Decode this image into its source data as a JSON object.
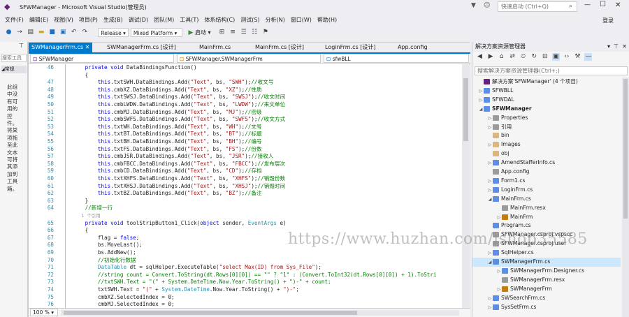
{
  "window": {
    "title": "SFWManager - Microsoft Visual Studio(管理员)",
    "quick_launch_placeholder": "快速启动 (Ctrl+Q)",
    "login_label": "登录"
  },
  "menu": [
    "文件(F)",
    "编辑(E)",
    "视图(V)",
    "项目(P)",
    "生成(B)",
    "调试(D)",
    "团队(M)",
    "工具(T)",
    "体系结构(C)",
    "测试(S)",
    "分析(N)",
    "窗口(W)",
    "帮助(H)"
  ],
  "toolbar": {
    "config": "Release",
    "platform": "Mixed Platform",
    "start_label": "启动"
  },
  "left_pane": {
    "search_placeholder": "搜索工具",
    "header": "常规",
    "message": "此组中没有可用的控件。将某项拖至此文本可将其添加到工具箱。"
  },
  "tabs": [
    {
      "label": "SWManagerFrm.cs",
      "active": true
    },
    {
      "label": "SWManagerFrm.cs [设计]",
      "active": false
    },
    {
      "label": "MainFrm.cs",
      "active": false
    },
    {
      "label": "MainFrm.cs [设计]",
      "active": false
    },
    {
      "label": "LoginFrm.cs [设计]",
      "active": false
    },
    {
      "label": "App.config",
      "active": false
    }
  ],
  "nav": {
    "project": "SFWManager",
    "class": "SFWManager.SWManagerFrm",
    "member": "sfwBLL"
  },
  "code_lines": [
    {
      "n": "46",
      "t": "        private void DataBindingsFunction()"
    },
    {
      "n": "",
      "t": "        {"
    },
    {
      "n": "47",
      "t": "            this.txtSWH.DataBindings.Add(\"Text\", bs, \"SWH\");//收文号"
    },
    {
      "n": "48",
      "t": "            this.cmbXZ.DataBindings.Add(\"Text\", bs, \"XZ\");//性质"
    },
    {
      "n": "49",
      "t": "            this.txtSWSJ.DataBindings.Add(\"Text\", bs, \"SWSJ\");//收文时间"
    },
    {
      "n": "50",
      "t": "            this.cmbLWDW.DataBindings.Add(\"Text\", bs, \"LWDW\");//来文单位"
    },
    {
      "n": "51",
      "t": "            this.cmbMJ.DataBindings.Add(\"Text\", bs, \"MJ\");//密级"
    },
    {
      "n": "52",
      "t": "            this.cmbSWFS.DataBindings.Add(\"Text\", bs, \"SWFS\");//收文方式"
    },
    {
      "n": "53",
      "t": "            this.txtWH.DataBindings.Add(\"Text\", bs, \"WH\");//文号"
    },
    {
      "n": "54",
      "t": "            this.txtBT.DataBindings.Add(\"Text\", bs, \"BT\");//标题"
    },
    {
      "n": "55",
      "t": "            this.txtBH.DataBindings.Add(\"Text\", bs, \"BH\");//编号"
    },
    {
      "n": "56",
      "t": "            this.txtFS.DataBindings.Add(\"Text\", bs, \"FS\");//份数"
    },
    {
      "n": "57",
      "t": "            this.cmbJSR.DataBindings.Add(\"Text\", bs, \"JSR\");//接收人"
    },
    {
      "n": "58",
      "t": "            this.cmbFBCC.DataBindings.Add(\"Text\", bs, \"FBCC\");//发布层次"
    },
    {
      "n": "59",
      "t": "            this.cmbCD.DataBindings.Add(\"Text\", bs, \"CD\");//存档"
    },
    {
      "n": "60",
      "t": "            this.txtXHFS.DataBindings.Add(\"Text\", bs, \"XHFS\");//销毁份数"
    },
    {
      "n": "61",
      "t": "            this.txtXHSJ.DataBindings.Add(\"Text\", bs, \"XHSJ\");//销毁时间"
    },
    {
      "n": "62",
      "t": "            this.txtBZ.DataBindings.Add(\"Text\", bs, \"BZ\");//备注"
    },
    {
      "n": "63",
      "t": "        }"
    },
    {
      "n": "64",
      "t": "        //新增一行"
    },
    {
      "n": "",
      "t": "        1 个引用"
    },
    {
      "n": "65",
      "t": "        private void toolStripButton1_Click(object sender, EventArgs e)"
    },
    {
      "n": "66",
      "t": "        {"
    },
    {
      "n": "67",
      "t": "            flag = false;"
    },
    {
      "n": "68",
      "t": "            bs.MoveLast();"
    },
    {
      "n": "69",
      "t": "            bs.AddNew();"
    },
    {
      "n": "70",
      "t": "            //初始化行数据"
    },
    {
      "n": "71",
      "t": "            DataTable dt = sqlHelper.ExecuteTable(\"select Max(ID) from Sys_File\");"
    },
    {
      "n": "72",
      "t": "            //string count = Convert.ToString(dt.Rows[0][0]) == \"\" ? \"1\" : (Convert.ToInt32(dt.Rows[0][0]) + 1).ToStri"
    },
    {
      "n": "73",
      "t": "            //txtSWH.Text = \"(\" + System.DateTime.Now.Year.ToString() + \")-\" + count;"
    },
    {
      "n": "74",
      "t": "            txtSWH.Text = \"(\" + System.DateTime.Now.Year.ToString() + \")-\";"
    },
    {
      "n": "75",
      "t": "            cmbXZ.SelectedIndex = 0;"
    },
    {
      "n": "76",
      "t": "            cmbMJ.SelectedIndex = 0;"
    }
  ],
  "zoom": "100 %",
  "watermark": "https://www.huzhan.com/ishop35585",
  "solution": {
    "title": "解决方案资源管理器",
    "search_placeholder": "搜索解决方案资源管理器(Ctrl+;)",
    "items": [
      {
        "label": "解决方案'SFWManager' (4 个项目)",
        "level": 0,
        "exp": "",
        "icon": "#68217a"
      },
      {
        "label": "SFWBLL",
        "level": 0,
        "exp": "▷",
        "icon": "#5c8ee6"
      },
      {
        "label": "SFWDAL",
        "level": 0,
        "exp": "▷",
        "icon": "#5c8ee6"
      },
      {
        "label": "SFWManager",
        "level": 0,
        "exp": "◢",
        "icon": "#5c8ee6",
        "bold": true
      },
      {
        "label": "Properties",
        "level": 1,
        "exp": "▷",
        "icon": "#9b9b9b"
      },
      {
        "label": "引用",
        "level": 1,
        "exp": "▷",
        "icon": "#9b9b9b"
      },
      {
        "label": "bin",
        "level": 1,
        "exp": "",
        "icon": "#dcb67a"
      },
      {
        "label": "Images",
        "level": 1,
        "exp": "▷",
        "icon": "#dcb67a"
      },
      {
        "label": "obj",
        "level": 1,
        "exp": "",
        "icon": "#dcb67a"
      },
      {
        "label": "AmendStafferInfo.cs",
        "level": 1,
        "exp": "▷",
        "icon": "#5c8ee6"
      },
      {
        "label": "App.config",
        "level": 1,
        "exp": "",
        "icon": "#9b9b9b"
      },
      {
        "label": "Form1.cs",
        "level": 1,
        "exp": "▷",
        "icon": "#5c8ee6"
      },
      {
        "label": "LoginFrm.cs",
        "level": 1,
        "exp": "▷",
        "icon": "#5c8ee6"
      },
      {
        "label": "MainFrm.cs",
        "level": 1,
        "exp": "◢",
        "icon": "#5c8ee6"
      },
      {
        "label": "MainFrm.resx",
        "level": 2,
        "exp": "",
        "icon": "#9b9b9b"
      },
      {
        "label": "MainFrm",
        "level": 2,
        "exp": "▷",
        "icon": "#c27d0e"
      },
      {
        "label": "Program.cs",
        "level": 1,
        "exp": "",
        "icon": "#5c8ee6"
      },
      {
        "label": "SFWManager.csproj.vspscc",
        "level": 1,
        "exp": "",
        "icon": "#9b9b9b"
      },
      {
        "label": "SFWManager.csproj.user",
        "level": 1,
        "exp": "",
        "icon": "#9b9b9b"
      },
      {
        "label": "SqlHelper.cs",
        "level": 1,
        "exp": "▷",
        "icon": "#5c8ee6"
      },
      {
        "label": "SWManagerFrm.cs",
        "level": 1,
        "exp": "◢",
        "icon": "#5c8ee6",
        "selected": true
      },
      {
        "label": "SWManagerFrm.Designer.cs",
        "level": 2,
        "exp": "▷",
        "icon": "#5c8ee6"
      },
      {
        "label": "SWManagerFrm.resx",
        "level": 2,
        "exp": "",
        "icon": "#9b9b9b"
      },
      {
        "label": "SWManagerFrm",
        "level": 2,
        "exp": "▷",
        "icon": "#c27d0e"
      },
      {
        "label": "SWSearchFrm.cs",
        "level": 1,
        "exp": "▷",
        "icon": "#5c8ee6"
      },
      {
        "label": "SysSetFrm.cs",
        "level": 1,
        "exp": "▷",
        "icon": "#5c8ee6"
      }
    ]
  }
}
